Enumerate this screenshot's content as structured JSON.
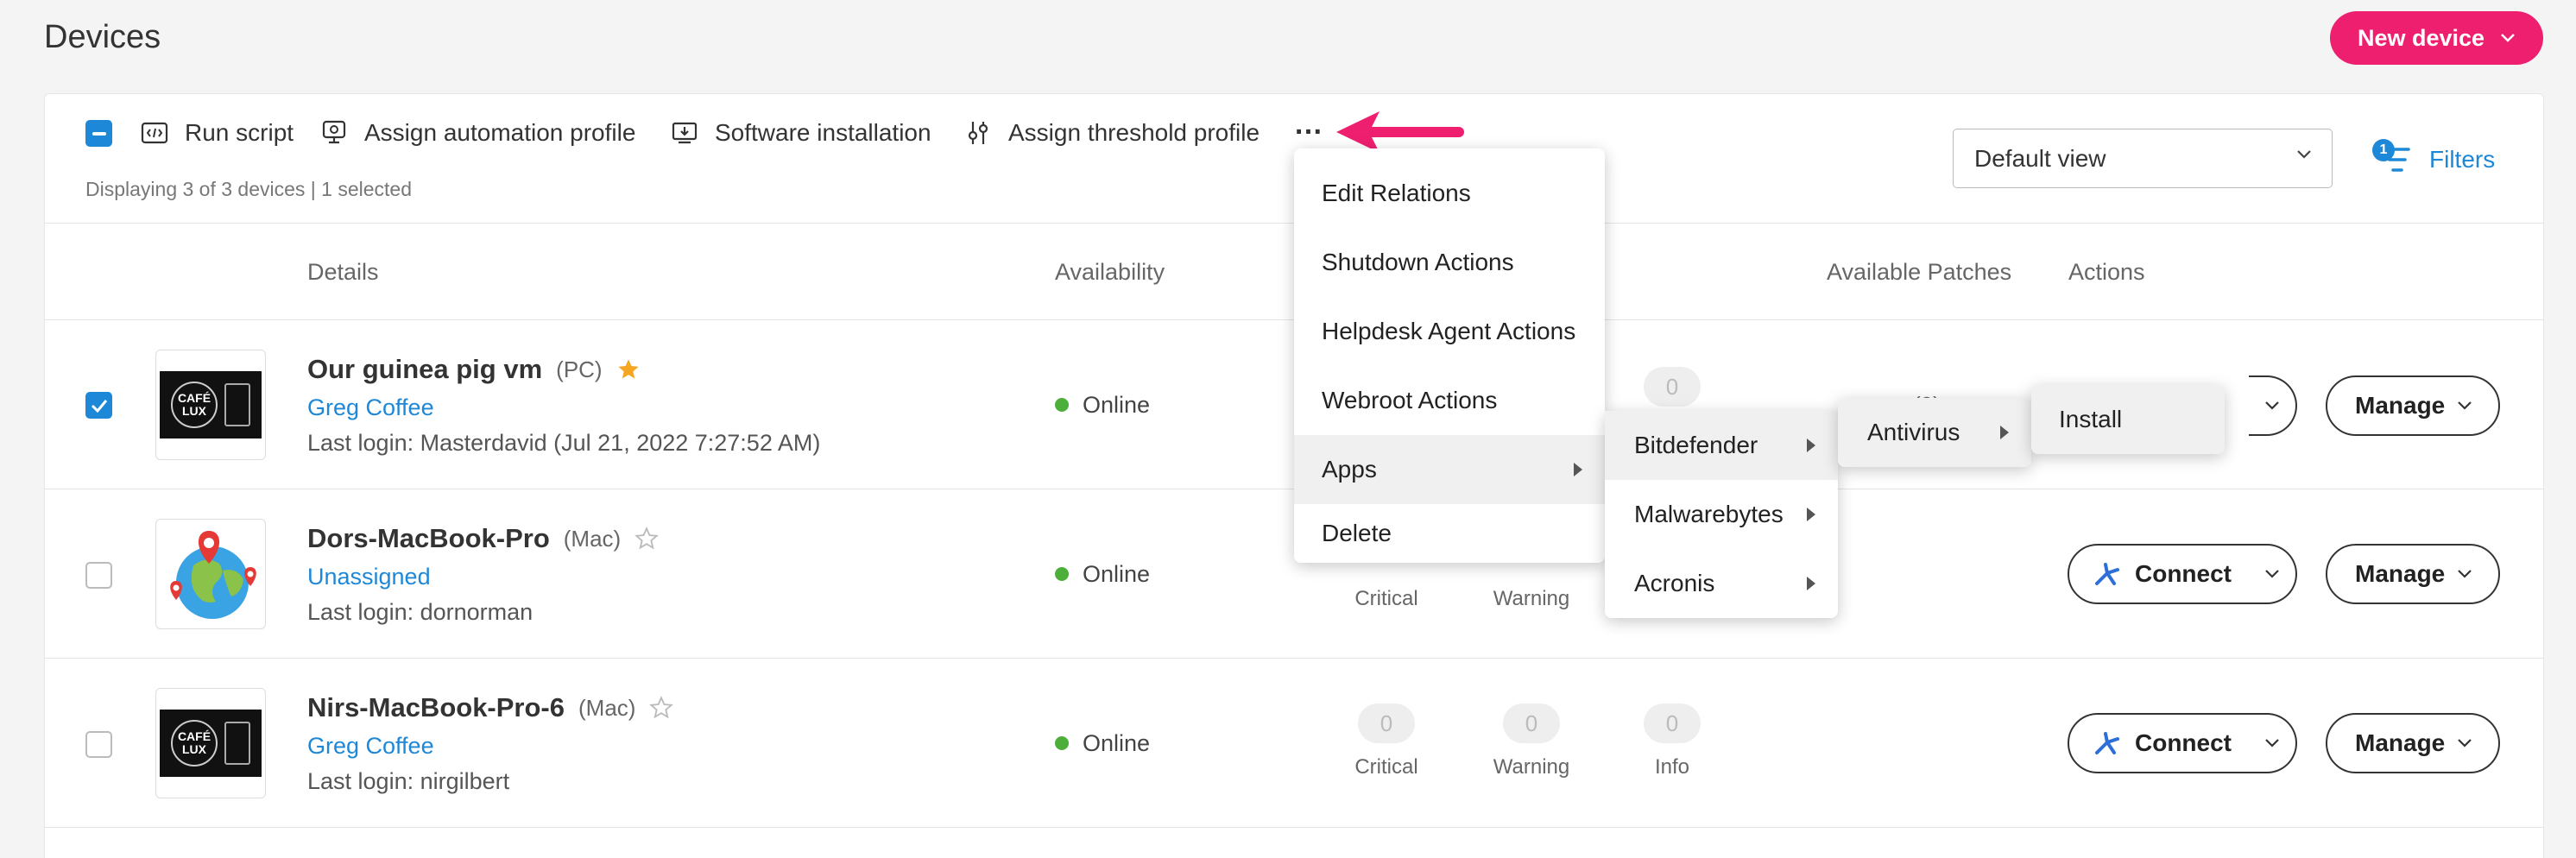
{
  "page_title": "Devices",
  "new_device_label": "New device",
  "toolbar": {
    "run_script": "Run script",
    "assign_automation": "Assign automation profile",
    "software_installation": "Software installation",
    "assign_threshold": "Assign threshold profile",
    "more": "…"
  },
  "display_text": "Displaying 3 of 3 devices | 1 selected",
  "view_select": "Default view",
  "filters": {
    "label": "Filters",
    "count": "1"
  },
  "columns": {
    "details": "Details",
    "availability": "Availability",
    "available_patches": "Available Patches",
    "actions": "Actions"
  },
  "devices": [
    {
      "name": "Our guinea pig vm",
      "type": "(PC)",
      "org": "Greg Coffee",
      "login": "Last login: Masterdavid (Jul 21, 2022 7:27:52 AM)",
      "status": "Online",
      "favorite": true,
      "selected": true,
      "alerts": {
        "critical": "",
        "warning": "",
        "info": "0"
      },
      "partial_patch": "(0)"
    },
    {
      "name": "Dors-MacBook-Pro",
      "type": "(Mac)",
      "org": "Unassigned",
      "login": "Last login: dornorman",
      "status": "Online",
      "favorite": false,
      "selected": false,
      "alerts": {
        "critical_label": "Critical",
        "warning_label": "Warning"
      }
    },
    {
      "name": "Nirs-MacBook-Pro-6",
      "type": "(Mac)",
      "org": "Greg Coffee",
      "login": "Last login: nirgilbert",
      "status": "Online",
      "favorite": false,
      "selected": false,
      "alerts": {
        "critical": "0",
        "warning": "0",
        "info": "0",
        "critical_label": "Critical",
        "warning_label": "Warning",
        "info_label": "Info"
      }
    }
  ],
  "logo": {
    "text1": "CAFÉ",
    "text2": "LUX"
  },
  "buttons": {
    "connect": "Connect",
    "manage": "Manage"
  },
  "menu_main": [
    "Edit Relations",
    "Shutdown Actions",
    "Helpdesk Agent Actions",
    "Webroot Actions",
    "Apps",
    "Delete"
  ],
  "menu_apps": [
    "Bitdefender",
    "Malwarebytes",
    "Acronis"
  ],
  "menu_bitdefender": [
    "Antivirus"
  ],
  "menu_antivirus": [
    "Install"
  ],
  "colors": {
    "accent": "#ef1f6f",
    "link": "#1e88d8",
    "online": "#4caf3a"
  }
}
